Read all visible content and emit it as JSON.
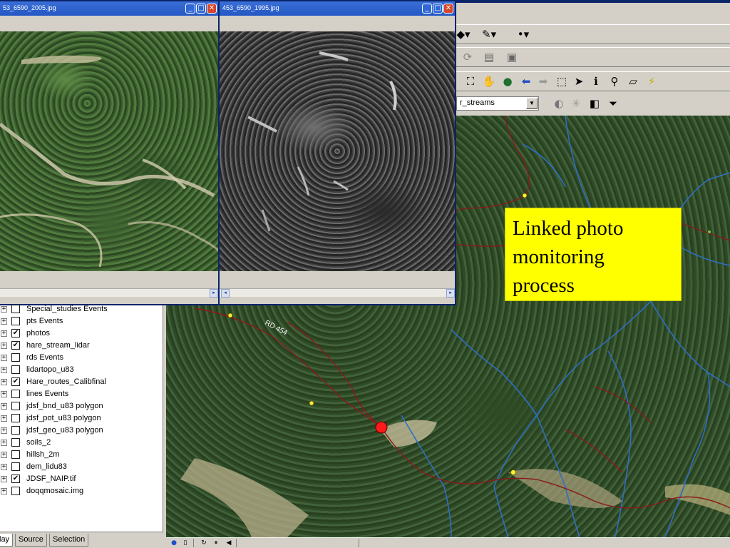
{
  "windows": [
    {
      "title": "53_6590_2005.jpg",
      "kind": "color"
    },
    {
      "title": "453_6590_1995.jpg",
      "kind": "bw"
    }
  ],
  "window_buttons": {
    "minimize": "_",
    "maximize": "□",
    "close": "✕"
  },
  "toolbar": {
    "layer_select_value": "r_streams",
    "row1_icons": [
      "style-dropdown-icon",
      "line-color-icon",
      "marker-color-icon"
    ],
    "row2_icons": [
      "rotate-icon",
      "table-icon",
      "image-icon"
    ],
    "row3_icons": [
      "full-extent-icon",
      "pan-icon",
      "globe-icon",
      "back-icon",
      "forward-icon",
      "select-features-icon",
      "select-element-icon",
      "identify-icon",
      "find-icon",
      "measure-icon",
      "hyperlink-icon"
    ],
    "row4_icons": [
      "contrast-icon",
      "brightness-icon",
      "transparency-icon",
      "display-options-icon"
    ]
  },
  "toc": {
    "layers": [
      {
        "name": "Special_studies Events",
        "checked": false
      },
      {
        "name": "pts Events",
        "checked": false
      },
      {
        "name": "photos",
        "checked": true
      },
      {
        "name": "hare_stream_lidar",
        "checked": true
      },
      {
        "name": "rds Events",
        "checked": false
      },
      {
        "name": "lidartopo_u83",
        "checked": false
      },
      {
        "name": "Hare_routes_Calibfinal",
        "checked": true
      },
      {
        "name": "lines Events",
        "checked": false
      },
      {
        "name": "jdsf_bnd_u83 polygon",
        "checked": false
      },
      {
        "name": "jdsf_pot_u83 polygon",
        "checked": false
      },
      {
        "name": "jdsf_geo_u83 polygon",
        "checked": false
      },
      {
        "name": "soils_2",
        "checked": false
      },
      {
        "name": "hillsh_2m",
        "checked": false
      },
      {
        "name": "dem_lidu83",
        "checked": false
      },
      {
        "name": "JDSF_NAIP.tif",
        "checked": true
      },
      {
        "name": "doqqmosaic.img",
        "checked": false
      }
    ],
    "expand_symbol": "+",
    "check_symbol": "✔",
    "tabs": [
      "lay",
      "Source",
      "Selection"
    ],
    "active_tab": "lay"
  },
  "map": {
    "road_label": "RD 454",
    "colors": {
      "road": "#8b1a1a",
      "stream": "#2e6fc4",
      "point": "#ff1a1a",
      "marker": "#ffee33"
    }
  },
  "callout": {
    "lines": [
      "Linked photo",
      "monitoring",
      "process"
    ],
    "background": "#ffff00"
  },
  "statusbar": {
    "icons": [
      "data-view-icon",
      "layout-view-icon",
      "refresh-icon",
      "pause-icon",
      "scroll-left-icon"
    ]
  }
}
